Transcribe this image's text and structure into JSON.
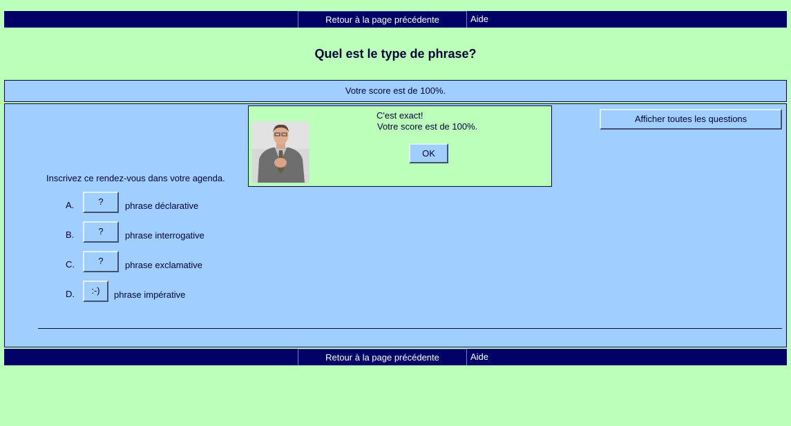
{
  "nav": {
    "back_label": "Retour à la page précédente",
    "help_label": "Aide"
  },
  "page_title": "Quel est le type de phrase?",
  "score_text": "Votre score est de 100%.",
  "show_all_label": "Afficher toutes les questions",
  "feedback": {
    "line1": "C'est exact!",
    "line2": "Votre score est de 100%.",
    "ok_label": "OK"
  },
  "question": "Inscrivez ce rendez-vous dans votre agenda.",
  "answers": [
    {
      "letter": "A.",
      "button": "?",
      "label": "phrase déclarative"
    },
    {
      "letter": "B.",
      "button": "?",
      "label": "phrase interrogative"
    },
    {
      "letter": "C.",
      "button": "?",
      "label": "phrase exclamative"
    },
    {
      "letter": "D.",
      "button": ":-)",
      "label": "phrase impérative"
    }
  ],
  "colors": {
    "page_bg": "#bbffbb",
    "nav_bg": "#000066",
    "panel_bg": "#a0cfff"
  }
}
